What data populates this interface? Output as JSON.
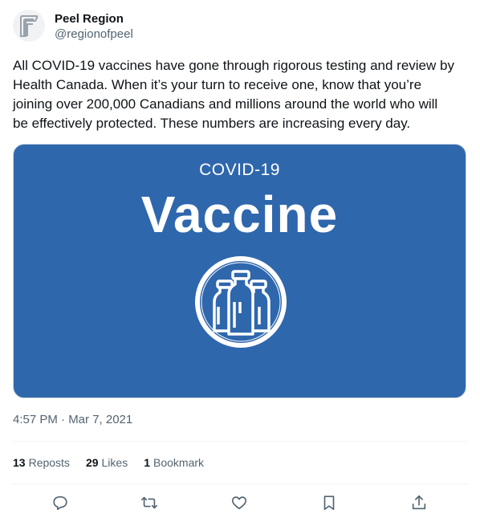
{
  "tweet": {
    "author": {
      "display_name": "Peel Region",
      "handle": "@regionofpeel",
      "avatar_icon": "peel-region-logo-icon"
    },
    "text": "All COVID-19 vaccines have gone through rigorous testing and review by\nHealth Canada. When it’s your turn to receive one, know that you’re\njoining over 200,000 Canadians and millions around the world who will\nbe effectively protected. These numbers are increasing every day.",
    "media": {
      "subtitle": "COVID-19",
      "title": "Vaccine",
      "icon": "vaccine-vials-icon",
      "background_color": "#2f67ad"
    },
    "timestamp": "4:57 PM · Mar 7, 2021",
    "stats": {
      "reposts_count": "13",
      "reposts_label": "Reposts",
      "likes_count": "29",
      "likes_label": "Likes",
      "bookmarks_count": "1",
      "bookmarks_label": "Bookmark"
    },
    "actions": [
      "reply-icon",
      "repost-icon",
      "like-icon",
      "bookmark-icon",
      "share-icon"
    ]
  }
}
